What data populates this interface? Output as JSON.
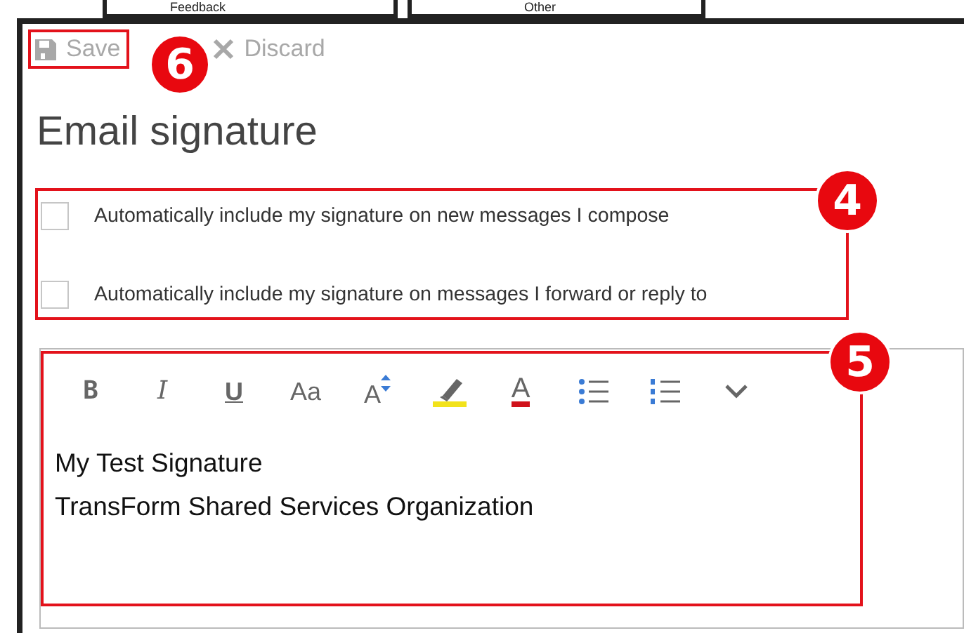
{
  "top_tabs": [
    {
      "label": "Feedback"
    },
    {
      "label": "Other"
    }
  ],
  "toolbar": [
    {
      "kind": "save",
      "label": "Save",
      "disabled": true,
      "callout": "6"
    },
    {
      "kind": "discard",
      "label": "Discard",
      "disabled": true
    }
  ],
  "title": "Email signature",
  "options": {
    "callout": "4",
    "items": [
      {
        "label": "Automatically include my signature on new messages I compose",
        "checked": false
      },
      {
        "label": "Automatically include my signature on messages I forward or reply to",
        "checked": false
      }
    ]
  },
  "editor": {
    "callout": "5",
    "format_bar": [
      {
        "kind": "bold",
        "label": "B"
      },
      {
        "kind": "italic",
        "label": "I"
      },
      {
        "kind": "underline",
        "label": "U"
      },
      {
        "kind": "font",
        "label": "Aa"
      },
      {
        "kind": "size",
        "label": "A"
      },
      {
        "kind": "highlight"
      },
      {
        "kind": "color",
        "label": "A"
      },
      {
        "kind": "bullets"
      },
      {
        "kind": "numbering"
      },
      {
        "kind": "more"
      }
    ],
    "signature_lines": [
      "My Test Signature",
      "TransForm Shared Services Organization"
    ]
  }
}
